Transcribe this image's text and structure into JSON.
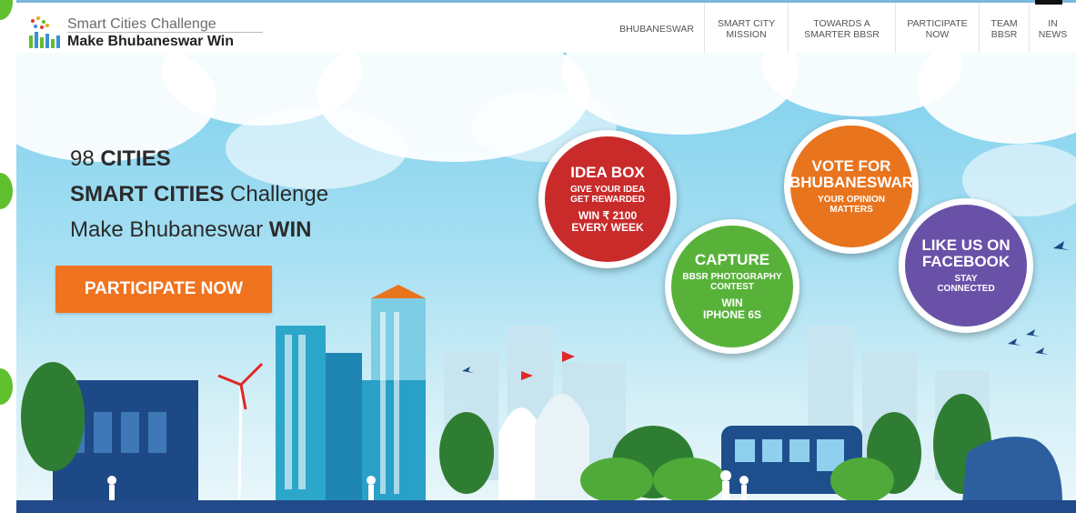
{
  "header": {
    "logo": {
      "title_line1": "Smart Cities Challenge",
      "title_line2": "Make Bhubaneswar Win"
    },
    "nav": [
      {
        "label": "BHUBANESWAR"
      },
      {
        "label": "SMART CITY\nMISSION"
      },
      {
        "label": "TOWARDS A\nSMARTER BBSR"
      },
      {
        "label": "PARTICIPATE\nNOW"
      },
      {
        "label": "TEAM\nBBSR"
      },
      {
        "label": "IN\nNEWS"
      }
    ]
  },
  "hero": {
    "line1_a": "98",
    "line1_b": "CITIES",
    "line2_a": "SMART CITIES",
    "line2_b": "Challenge",
    "line3_a": "Make Bhubaneswar",
    "line3_b": "WIN",
    "cta_label": "PARTICIPATE NOW"
  },
  "badges": [
    {
      "title": "IDEA BOX",
      "subtitle": "GIVE YOUR IDEA\nGET REWARDED",
      "extra": "WIN ₹ 2100\nEVERY WEEK",
      "color": "#c92b2b"
    },
    {
      "title": "CAPTURE",
      "subtitle": "BBSR PHOTOGRAPHY\nCONTEST",
      "extra": "WIN\nIPHONE 6S",
      "color": "#58b23a"
    },
    {
      "title": "VOTE FOR\nBHUBANESWAR",
      "subtitle": "YOUR OPINION\nMATTERS",
      "extra": "",
      "color": "#e8741e"
    },
    {
      "title": "LIKE US ON\nFACEBOOK",
      "subtitle": "STAY\nCONNECTED",
      "extra": "",
      "color": "#6a51a8"
    }
  ],
  "colors": {
    "accent_orange": "#f0731f",
    "sky": "#8fd6ef",
    "city_blue": "#1f4f8f",
    "nav_border_top": "#7db6dd"
  }
}
